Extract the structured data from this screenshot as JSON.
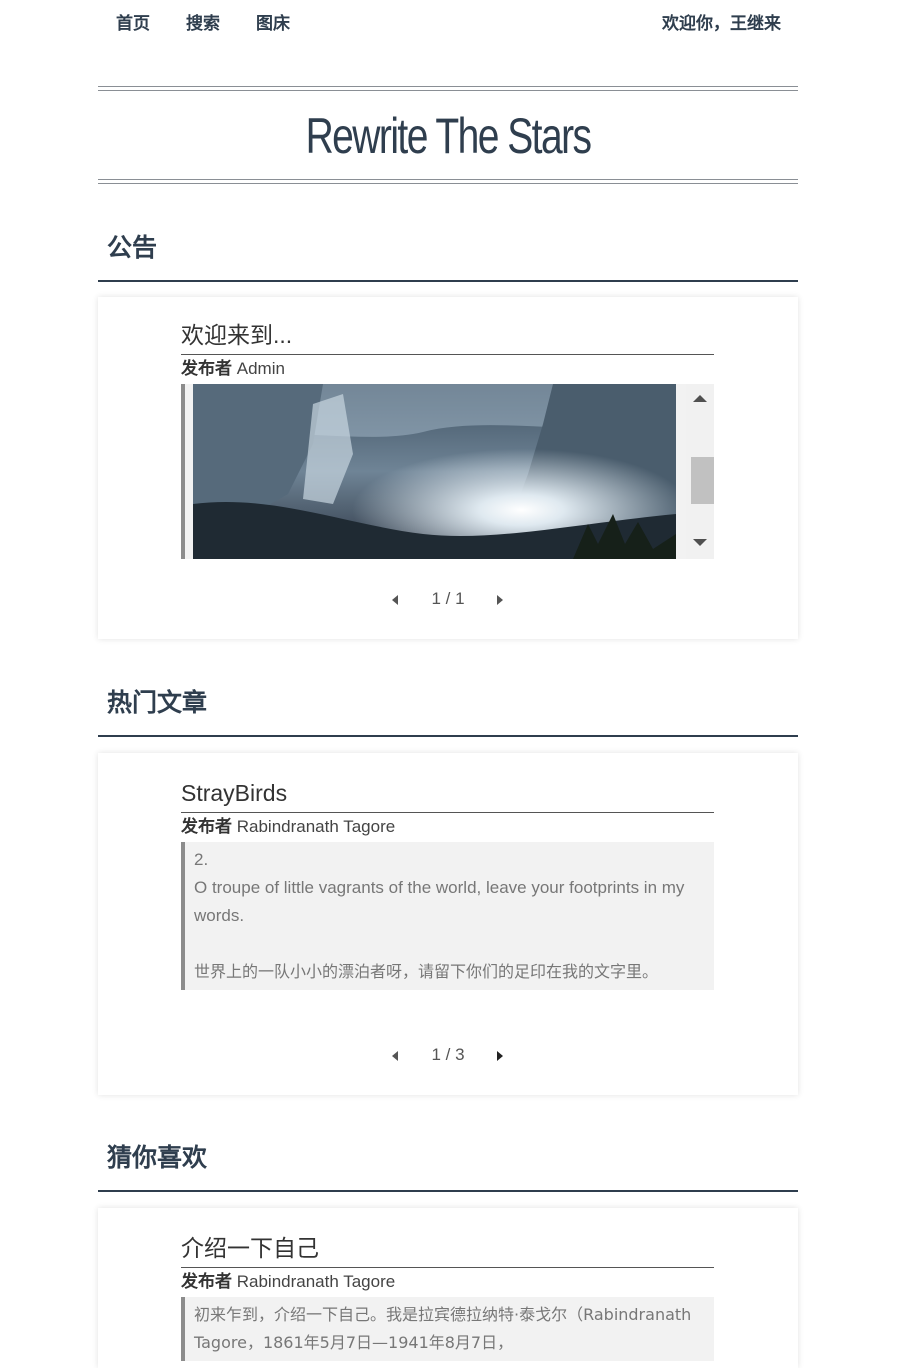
{
  "nav": {
    "items": [
      "首页",
      "搜索",
      "图床"
    ],
    "welcome": "欢迎你，王继来"
  },
  "site": {
    "title": "Rewrite The Stars"
  },
  "sections": {
    "announcement": {
      "heading": "公告",
      "post": {
        "title": "欢迎来到...",
        "meta_label": "发布者",
        "author": "Admin"
      },
      "pager": "1 / 1"
    },
    "popular": {
      "heading": "热门文章",
      "post": {
        "title": "StrayBirds",
        "meta_label": "发布者",
        "author": "Rabindranath Tagore",
        "excerpt_num": "2.",
        "excerpt_en": "O troupe of little vagrants of the world, leave your footprints in my words.",
        "excerpt_zh": "世界上的一队小小的漂泊者呀，请留下你们的足印在我的文字里。"
      },
      "pager": "1 / 3"
    },
    "recommend": {
      "heading": "猜你喜欢",
      "post": {
        "title": "介绍一下自己",
        "meta_label": "发布者",
        "author": "Rabindranath Tagore",
        "excerpt": "初来乍到，介绍一下自己。我是拉宾德拉纳特·泰戈尔（Rabindranath Tagore，1861年5月7日—1941年8月7日，"
      }
    }
  },
  "colors": {
    "text_primary": "#2f3e4e",
    "quote_bg": "#f2f2f2",
    "quote_border": "#8c8c8c"
  },
  "icons": {
    "pager_prev": "triangle-left",
    "pager_next": "triangle-right",
    "scroll_up": "triangle-up",
    "scroll_down": "triangle-down"
  }
}
